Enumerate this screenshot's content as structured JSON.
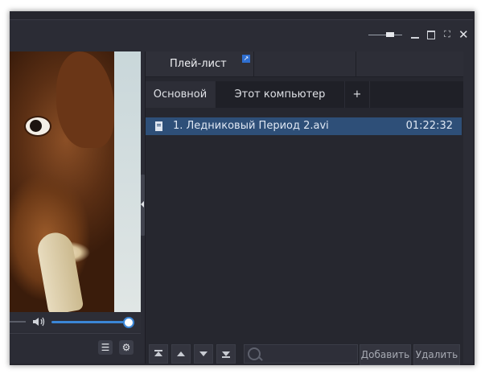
{
  "window": {
    "controls": {
      "opacity_level": 0.7,
      "minimize_icon": "minimize-icon",
      "maximize_icon": "maximize-icon",
      "fullscreen_icon": "fullscreen-icon",
      "close_icon": "close-icon"
    }
  },
  "player": {
    "volume_level": 1.0,
    "speaker_icon": "speaker-icon",
    "buttons": [
      "playlist-toggle-icon",
      "settings-gear-icon"
    ]
  },
  "playlist": {
    "tab_label": "Плей-лист",
    "subtabs": [
      {
        "label": "Основной",
        "active": true
      },
      {
        "label": "Этот компьютер",
        "active": false
      },
      {
        "label": "+",
        "active": false
      }
    ],
    "items": [
      {
        "title": "1. Ледниковый Период 2.avi",
        "duration": "01:22:32",
        "selected": true
      }
    ],
    "toolbar": {
      "add_label": "Добавить",
      "delete_label": "Удалить",
      "search_placeholder": ""
    }
  },
  "colors": {
    "accent": "#3b86d6",
    "selection": "#2e4f78",
    "background": "#26272f"
  }
}
